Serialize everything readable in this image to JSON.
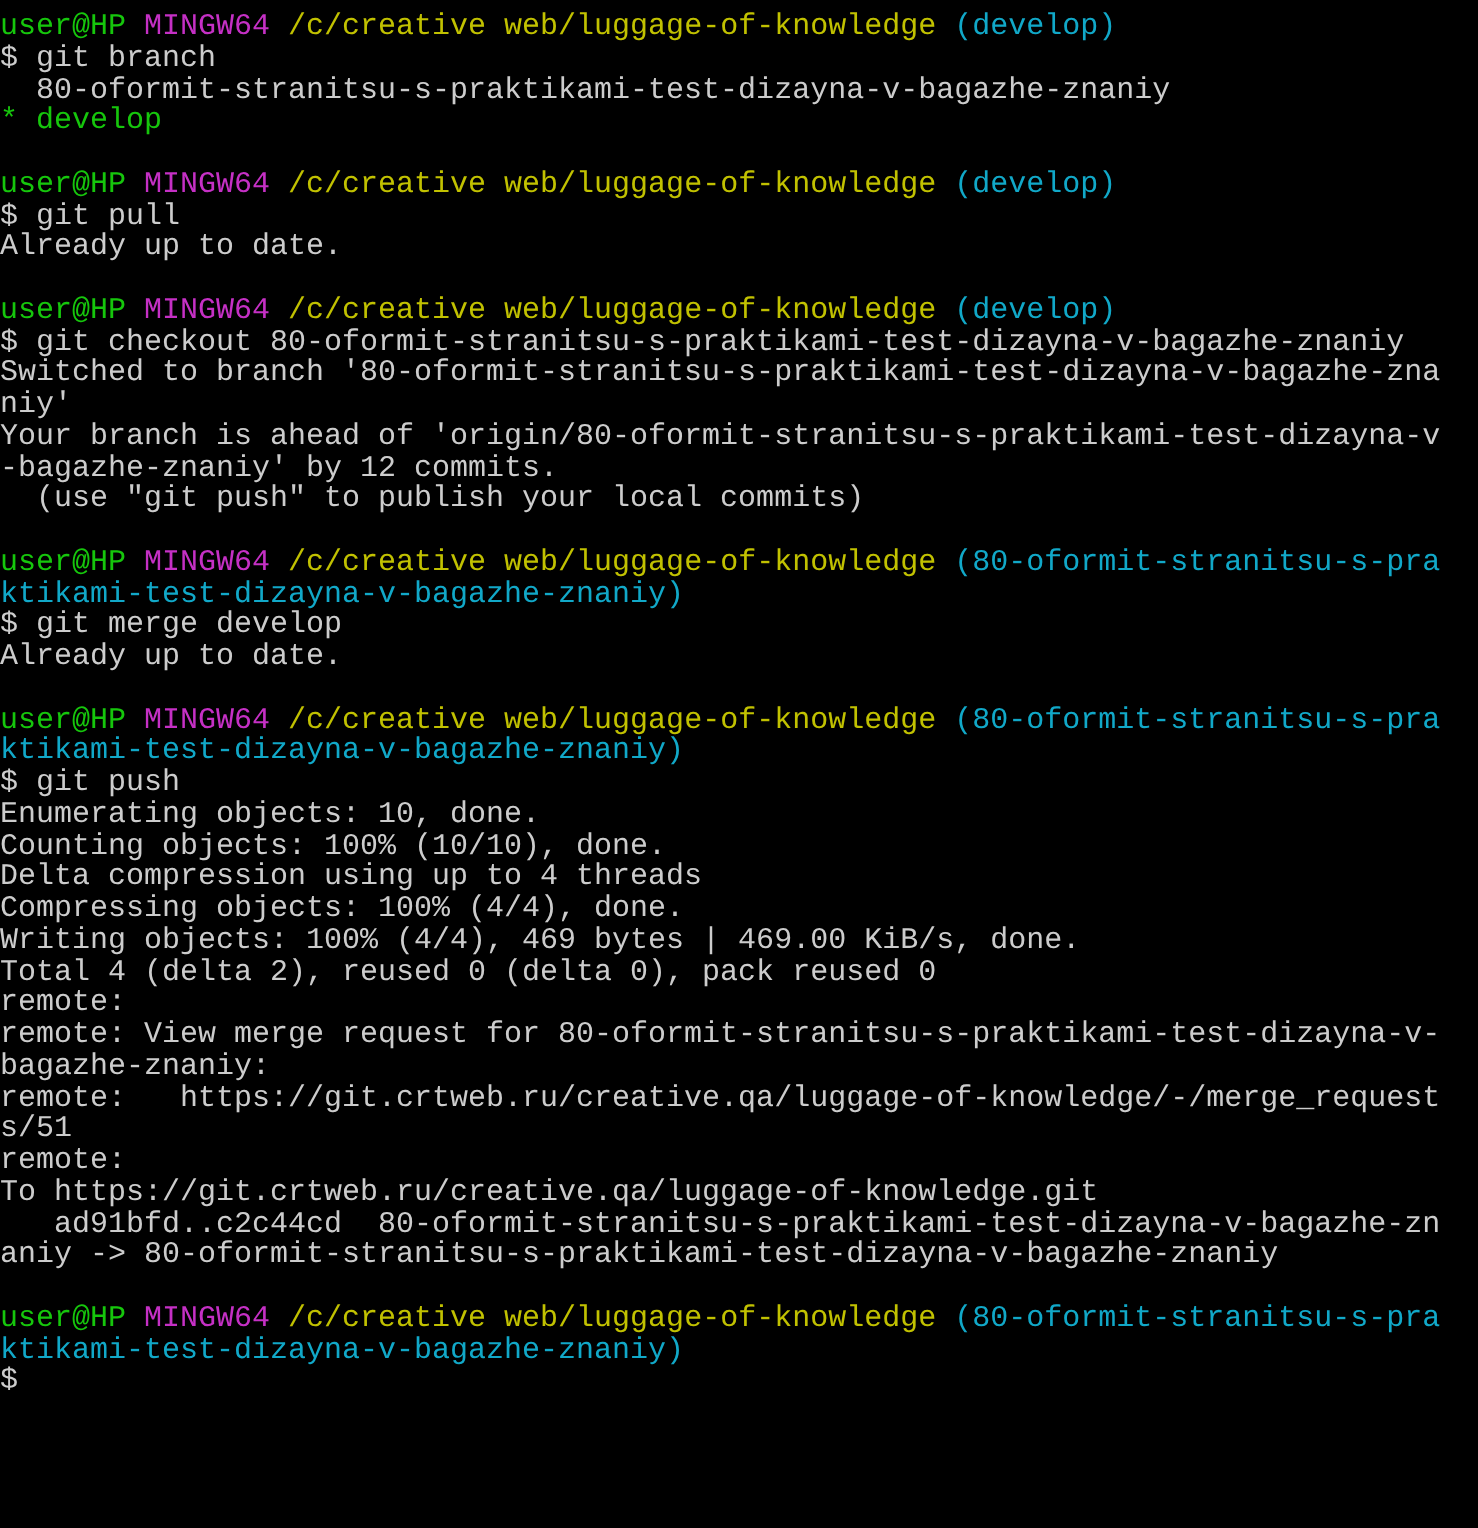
{
  "terminal": {
    "lines": [
      {
        "segments": [
          {
            "kind": "user",
            "text": "user@HP"
          },
          {
            "kind": "host",
            "text": "MINGW64"
          },
          {
            "kind": "path",
            "text": "/c/creative web/luggage-of-knowledge"
          },
          {
            "kind": "branch",
            "text": "(develop)"
          }
        ]
      },
      {
        "segments": [
          {
            "kind": "command",
            "text": "$ git branch"
          }
        ]
      },
      {
        "segments": [
          {
            "kind": "output",
            "text": "  80-oformit-stranitsu-s-praktikami-test-dizayna-v-bagazhe-znaniy"
          }
        ]
      },
      {
        "segments": [
          {
            "kind": "current_branch",
            "text": "* develop"
          }
        ]
      },
      {
        "blank_before": true,
        "segments": [
          {
            "kind": "user",
            "text": "user@HP"
          },
          {
            "kind": "host",
            "text": "MINGW64"
          },
          {
            "kind": "path",
            "text": "/c/creative web/luggage-of-knowledge"
          },
          {
            "kind": "branch",
            "text": "(develop)"
          }
        ]
      },
      {
        "segments": [
          {
            "kind": "command",
            "text": "$ git pull"
          }
        ]
      },
      {
        "segments": [
          {
            "kind": "output",
            "text": "Already up to date."
          }
        ]
      },
      {
        "blank_before": true,
        "segments": [
          {
            "kind": "user",
            "text": "user@HP"
          },
          {
            "kind": "host",
            "text": "MINGW64"
          },
          {
            "kind": "path",
            "text": "/c/creative web/luggage-of-knowledge"
          },
          {
            "kind": "branch",
            "text": "(develop)"
          }
        ]
      },
      {
        "segments": [
          {
            "kind": "command",
            "text": "$ git checkout 80-oformit-stranitsu-s-praktikami-test-dizayna-v-bagazhe-znaniy"
          }
        ]
      },
      {
        "segments": [
          {
            "kind": "output",
            "text": "Switched to branch '80-oformit-stranitsu-s-praktikami-test-dizayna-v-bagazhe-zna"
          }
        ]
      },
      {
        "segments": [
          {
            "kind": "output",
            "text": "niy'"
          }
        ]
      },
      {
        "segments": [
          {
            "kind": "output",
            "text": "Your branch is ahead of 'origin/80-oformit-stranitsu-s-praktikami-test-dizayna-v"
          }
        ]
      },
      {
        "segments": [
          {
            "kind": "output",
            "text": "-bagazhe-znaniy' by 12 commits."
          }
        ]
      },
      {
        "segments": [
          {
            "kind": "output",
            "text": "  (use \"git push\" to publish your local commits)"
          }
        ]
      },
      {
        "blank_before": true,
        "segments": [
          {
            "kind": "user",
            "text": "user@HP"
          },
          {
            "kind": "host",
            "text": "MINGW64"
          },
          {
            "kind": "path",
            "text": "/c/creative web/luggage-of-knowledge"
          },
          {
            "kind": "branch",
            "text": "(80-oformit-stranitsu-s-pra"
          }
        ]
      },
      {
        "segments": [
          {
            "kind": "branch",
            "text": "ktikami-test-dizayna-v-bagazhe-znaniy)"
          }
        ]
      },
      {
        "segments": [
          {
            "kind": "command",
            "text": "$ git merge develop"
          }
        ]
      },
      {
        "segments": [
          {
            "kind": "output",
            "text": "Already up to date."
          }
        ]
      },
      {
        "blank_before": true,
        "segments": [
          {
            "kind": "user",
            "text": "user@HP"
          },
          {
            "kind": "host",
            "text": "MINGW64"
          },
          {
            "kind": "path",
            "text": "/c/creative web/luggage-of-knowledge"
          },
          {
            "kind": "branch",
            "text": "(80-oformit-stranitsu-s-pra"
          }
        ]
      },
      {
        "segments": [
          {
            "kind": "branch",
            "text": "ktikami-test-dizayna-v-bagazhe-znaniy)"
          }
        ]
      },
      {
        "segments": [
          {
            "kind": "command",
            "text": "$ git push"
          }
        ]
      },
      {
        "segments": [
          {
            "kind": "output",
            "text": "Enumerating objects: 10, done."
          }
        ]
      },
      {
        "segments": [
          {
            "kind": "output",
            "text": "Counting objects: 100% (10/10), done."
          }
        ]
      },
      {
        "segments": [
          {
            "kind": "output",
            "text": "Delta compression using up to 4 threads"
          }
        ]
      },
      {
        "segments": [
          {
            "kind": "output",
            "text": "Compressing objects: 100% (4/4), done."
          }
        ]
      },
      {
        "segments": [
          {
            "kind": "output",
            "text": "Writing objects: 100% (4/4), 469 bytes | 469.00 KiB/s, done."
          }
        ]
      },
      {
        "segments": [
          {
            "kind": "output",
            "text": "Total 4 (delta 2), reused 0 (delta 0), pack reused 0"
          }
        ]
      },
      {
        "segments": [
          {
            "kind": "output",
            "text": "remote:"
          }
        ]
      },
      {
        "segments": [
          {
            "kind": "output",
            "text": "remote: View merge request for 80-oformit-stranitsu-s-praktikami-test-dizayna-v-"
          }
        ]
      },
      {
        "segments": [
          {
            "kind": "output",
            "text": "bagazhe-znaniy:"
          }
        ]
      },
      {
        "segments": [
          {
            "kind": "output",
            "text": "remote:   https://git.crtweb.ru/creative.qa/luggage-of-knowledge/-/merge_request"
          }
        ]
      },
      {
        "segments": [
          {
            "kind": "output",
            "text": "s/51"
          }
        ]
      },
      {
        "segments": [
          {
            "kind": "output",
            "text": "remote:"
          }
        ]
      },
      {
        "segments": [
          {
            "kind": "output",
            "text": "To https://git.crtweb.ru/creative.qa/luggage-of-knowledge.git"
          }
        ]
      },
      {
        "segments": [
          {
            "kind": "output",
            "text": "   ad91bfd..c2c44cd  80-oformit-stranitsu-s-praktikami-test-dizayna-v-bagazhe-zn"
          }
        ]
      },
      {
        "segments": [
          {
            "kind": "output",
            "text": "aniy -> 80-oformit-stranitsu-s-praktikami-test-dizayna-v-bagazhe-znaniy"
          }
        ]
      },
      {
        "blank_before": true,
        "segments": [
          {
            "kind": "user",
            "text": "user@HP"
          },
          {
            "kind": "host",
            "text": "MINGW64"
          },
          {
            "kind": "path",
            "text": "/c/creative web/luggage-of-knowledge"
          },
          {
            "kind": "branch",
            "text": "(80-oformit-stranitsu-s-pra"
          }
        ]
      },
      {
        "segments": [
          {
            "kind": "branch",
            "text": "ktikami-test-dizayna-v-bagazhe-znaniy)"
          }
        ]
      },
      {
        "segments": [
          {
            "kind": "command",
            "text": "$"
          }
        ]
      }
    ]
  }
}
